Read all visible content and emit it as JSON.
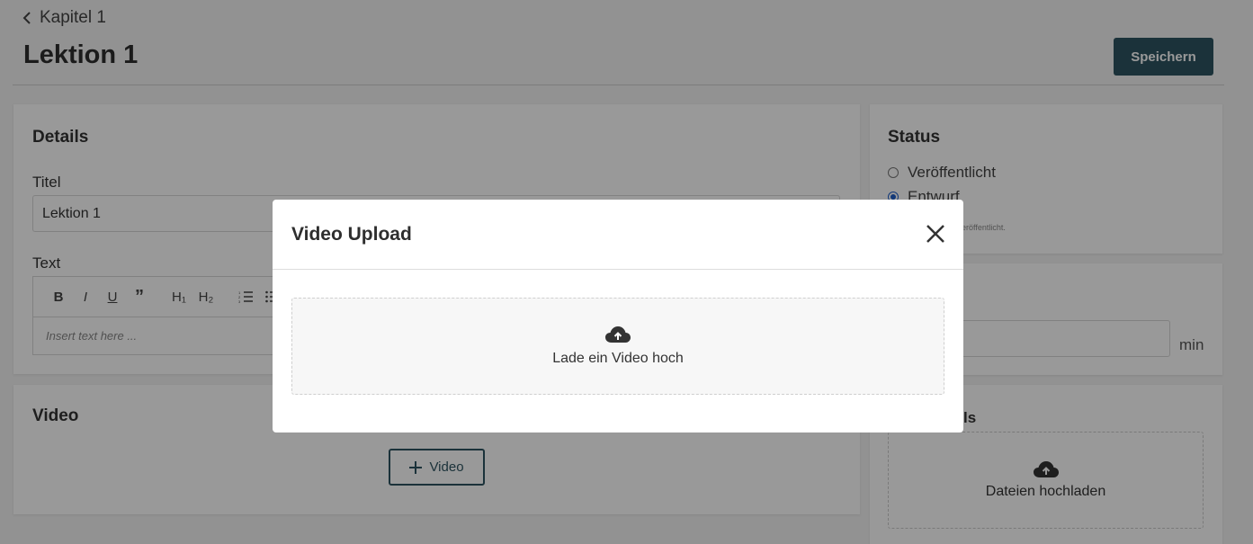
{
  "header": {
    "back_label": "Kapitel 1",
    "page_title": "Lektion 1",
    "save_label": "Speichern"
  },
  "details": {
    "title": "Details",
    "title_label": "Titel",
    "title_value": "Lektion 1",
    "text_label": "Text",
    "editor_placeholder": "Insert text here ...",
    "toolbar": [
      "B",
      "I",
      "U",
      "”",
      "H₁",
      "H₂"
    ]
  },
  "video_card": {
    "title": "Video",
    "add_video_label": "Video"
  },
  "status": {
    "title": "Status",
    "options": [
      "Veröffentlicht",
      "Entwurf"
    ],
    "selected": "Entwurf",
    "hint_visible": "eröffentlicht."
  },
  "duration": {
    "unit": "min"
  },
  "files": {
    "title_visible": "ls",
    "upload_label": "Dateien hochladen"
  },
  "modal": {
    "title": "Video Upload",
    "dropzone_label": "Lade ein Video hoch"
  },
  "colors": {
    "primary": "#2e5461",
    "radio_selected": "#2060c8"
  }
}
